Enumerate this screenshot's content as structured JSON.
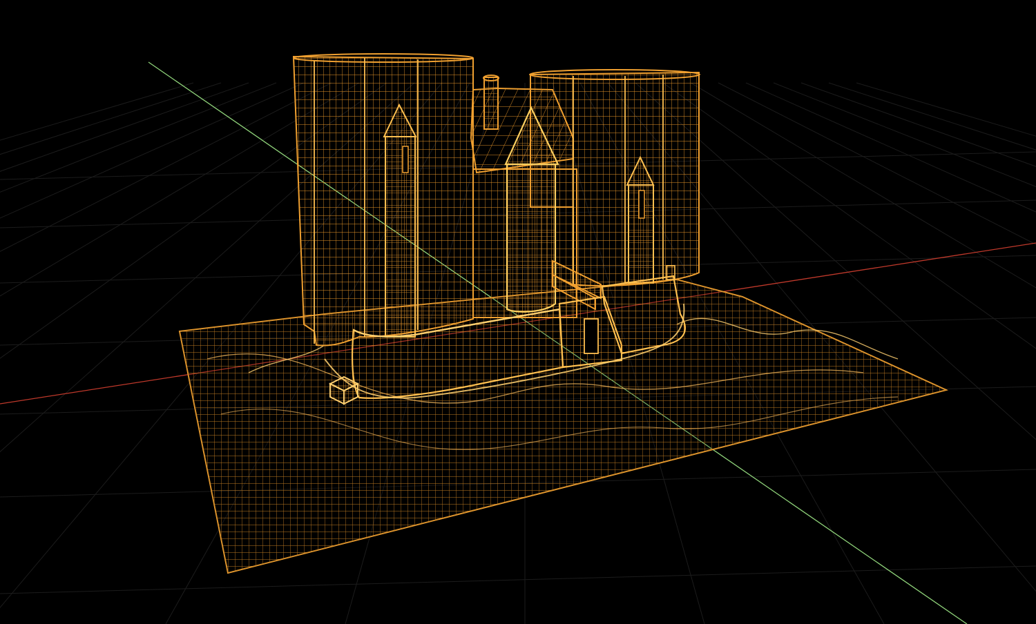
{
  "viewport": {
    "mode": "wireframe",
    "background": "#000000",
    "wire_color": "#f0a030",
    "wire_highlight": "#ffd060",
    "grid_color": "#1c1c1c",
    "x_axis_color": "#c0392b",
    "y_axis_color": "#8fd37a"
  },
  "scene": {
    "objects": [
      {
        "name": "terrain",
        "kind": "displaced-plane"
      },
      {
        "name": "castle-keep",
        "kind": "building"
      },
      {
        "name": "left-round-tower",
        "kind": "cylinder"
      },
      {
        "name": "right-round-tower",
        "kind": "cylinder"
      },
      {
        "name": "left-turret",
        "kind": "cone-tower"
      },
      {
        "name": "center-turret",
        "kind": "cone-tower"
      },
      {
        "name": "right-turret",
        "kind": "cone-tower"
      },
      {
        "name": "curtain-wall",
        "kind": "wall"
      },
      {
        "name": "gatehouse",
        "kind": "box"
      },
      {
        "name": "chimney",
        "kind": "cylinder"
      },
      {
        "name": "small-block",
        "kind": "box"
      }
    ]
  }
}
